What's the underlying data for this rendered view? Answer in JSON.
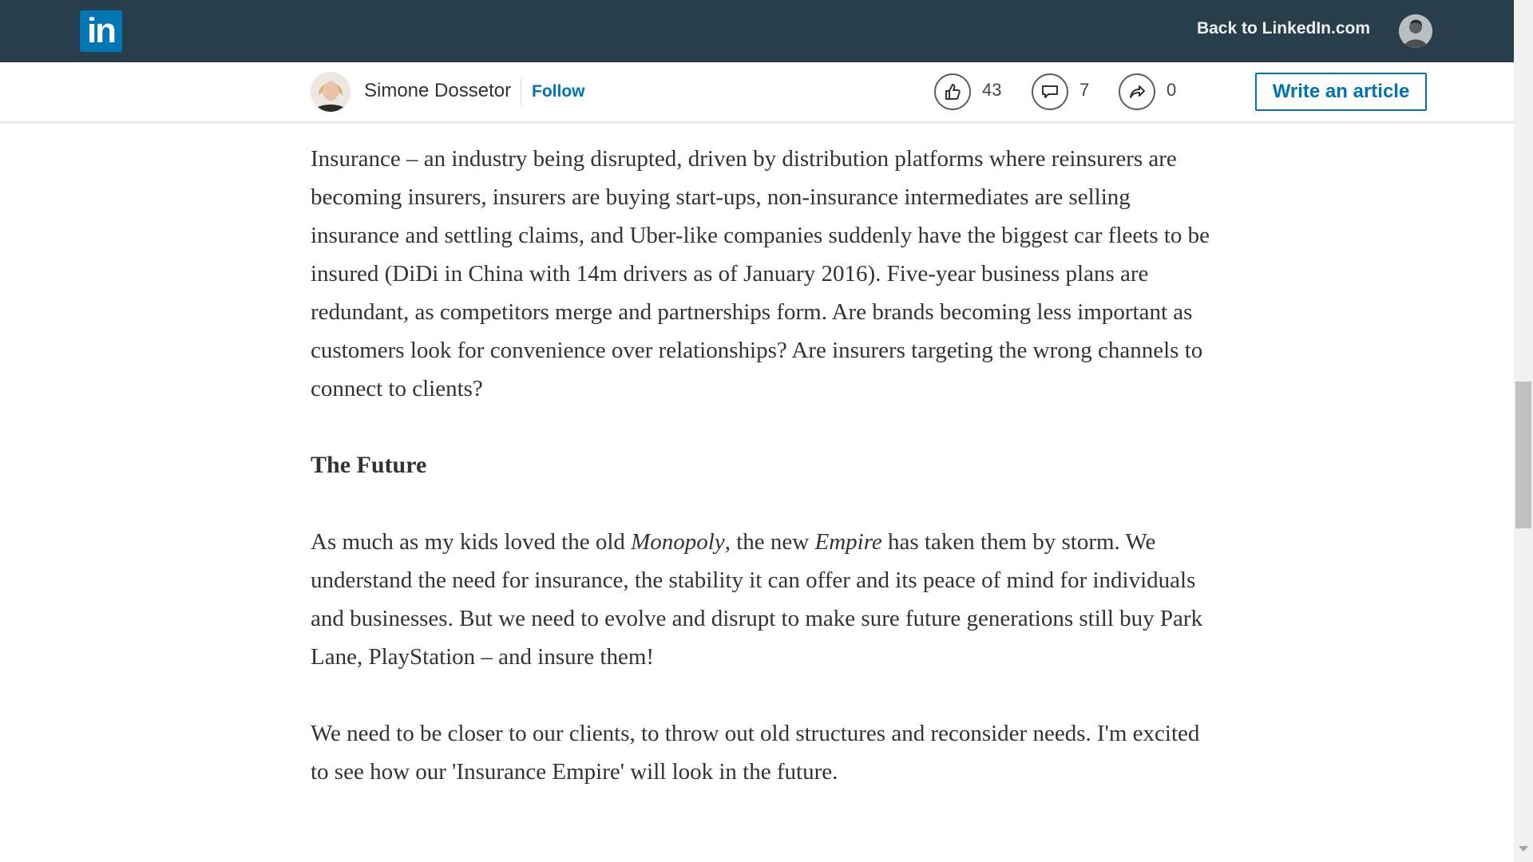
{
  "topbar": {
    "logo_text": "in",
    "back_link": "Back to LinkedIn.com"
  },
  "author": {
    "name": "Simone Dossetor",
    "follow_label": "Follow"
  },
  "social": {
    "likes": "43",
    "comments": "7",
    "shares": "0"
  },
  "actions": {
    "write_article": "Write an article"
  },
  "article": {
    "paragraph1": "Insurance – an industry being disrupted, driven by distribution platforms where reinsurers are becoming insurers, insurers are buying start-ups, non-insurance intermediates are selling insurance and settling claims, and Uber-like companies suddenly have the biggest car fleets to be insured (DiDi in China with 14m drivers as of January 2016). Five-year business plans are redundant, as competitors merge and partnerships form. Are brands becoming less important as customers look for convenience over relationships? Are insurers targeting the wrong channels to connect to clients?",
    "heading": "The Future",
    "p2_a": "As much as my kids loved the old ",
    "p2_monopoly": "Monopoly",
    "p2_b": ", the new ",
    "p2_empire": "Empire",
    "p2_c": " has taken them by storm. We understand the need for insurance, the stability it can offer and its peace of mind for individuals and businesses. But we need to evolve and disrupt to make sure future generations still buy Park Lane, PlayStation – and insure them!",
    "paragraph3": "We need to be closer to our clients, to throw out old structures and reconsider needs. I'm excited to see how our 'Insurance Empire' will look in the future."
  },
  "colors": {
    "topbar": "#283e4a",
    "linkedin_blue": "#0077b5",
    "link": "#0073b1",
    "text": "#333333"
  },
  "icons": {
    "like": "thumbs-up-icon",
    "comment": "comment-icon",
    "share": "share-arrow-icon"
  }
}
